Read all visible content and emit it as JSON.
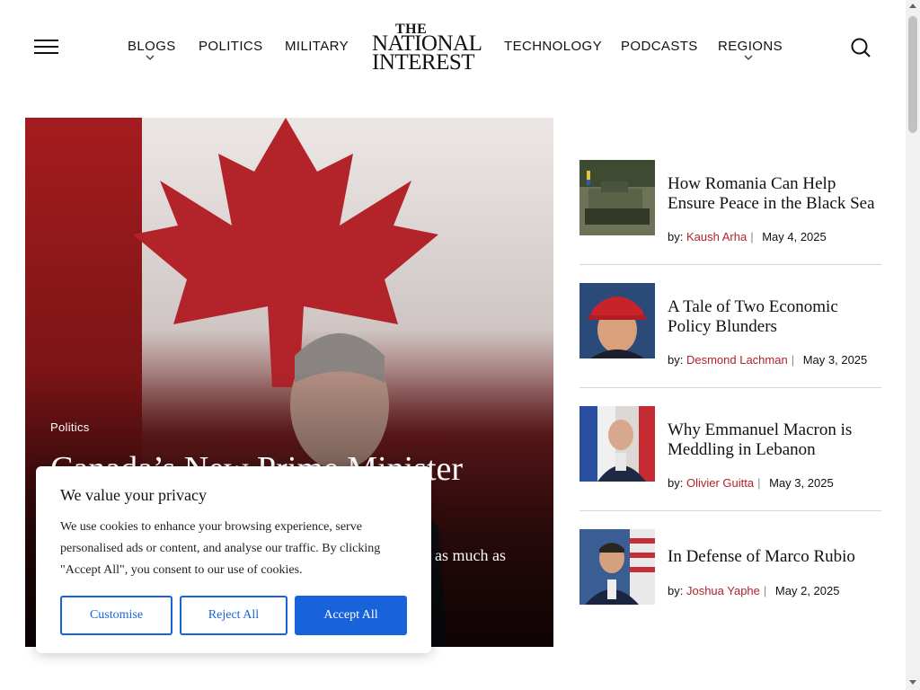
{
  "header": {
    "menu_icon": "hamburger-menu-icon",
    "nav_left": [
      {
        "label": "BLOGS",
        "has_dropdown": true
      },
      {
        "label": "POLITICS",
        "has_dropdown": false
      },
      {
        "label": "MILITARY",
        "has_dropdown": false
      }
    ],
    "logo": {
      "line1": "THE",
      "line2": "NATIONAL",
      "line3": "INTEREST"
    },
    "nav_right": [
      {
        "label": "TECHNOLOGY",
        "has_dropdown": false
      },
      {
        "label": "PODCASTS",
        "has_dropdown": false
      },
      {
        "label": "REGIONS",
        "has_dropdown": true
      }
    ],
    "search_icon": "search-icon"
  },
  "hero": {
    "category": "Politics",
    "title": "Canada’s New Prime Minister Must",
    "excerpt": "as much as"
  },
  "articles": [
    {
      "title": "How Romania Can Help Ensure Peace in the Black Sea",
      "by": "by:",
      "author": "Kaush Arha",
      "date": "May 4, 2025"
    },
    {
      "title": "A Tale of Two Economic Policy Blunders",
      "by": "by:",
      "author": "Desmond Lachman",
      "date": "May 3, 2025"
    },
    {
      "title": "Why Emmanuel Macron is Meddling in Lebanon",
      "by": "by:",
      "author": "Olivier Guitta",
      "date": "May 3, 2025"
    },
    {
      "title": "In Defense of Marco Rubio",
      "by": "by:",
      "author": "Joshua Yaphe",
      "date": "May 2, 2025"
    }
  ],
  "cookie": {
    "title": "We value your privacy",
    "text": "We use cookies to enhance your browsing experience, serve personalised ads or content, and analyse our traffic. By clicking \"Accept All\", you consent to our use of cookies.",
    "customise": "Customise",
    "reject": "Reject All",
    "accept": "Accept All"
  },
  "colors": {
    "accent_author": "#b0232a",
    "cookie_blue": "#1863dc"
  }
}
